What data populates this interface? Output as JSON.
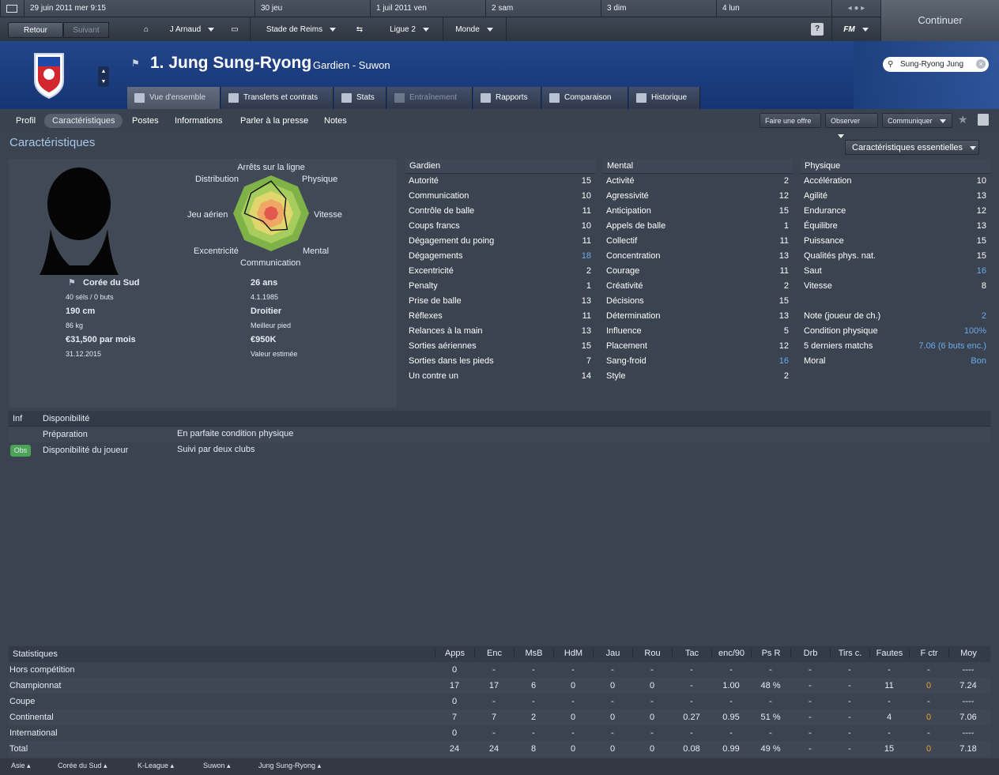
{
  "datebar": [
    {
      "label": "29 juin 2011  mer  9:15"
    },
    {
      "label": "30  jeu"
    },
    {
      "label": "1 juil 2011  ven"
    },
    {
      "label": "2  sam"
    },
    {
      "label": "3  dim"
    },
    {
      "label": "4  lun"
    }
  ],
  "nav": {
    "back": "Retour",
    "forward": "Suivant",
    "manager": "J Arnaud",
    "club": "Stade de Reims",
    "league": "Ligue 2",
    "world": "Monde",
    "help": "?",
    "fm": "FM",
    "continue": "Continuer"
  },
  "player": {
    "title": "1. Jung Sung-Ryong",
    "subtitle": "Gardien - Suwon",
    "search_value": "Sung-Ryong Jung"
  },
  "tabs": [
    "Vue d'ensemble",
    "Transferts et contrats",
    "Stats",
    "Entraînement",
    "Rapports",
    "Comparaison",
    "Historique"
  ],
  "subnav": [
    "Profil",
    "Caractéristiques",
    "Postes",
    "Informations",
    "Parler à la presse",
    "Notes"
  ],
  "actions": {
    "offer": "Faire une offre",
    "observe": "Observer",
    "communicate": "Communiquer"
  },
  "section_title": "Caractéristiques",
  "view_select": "Caractéristiques essentielles",
  "radar": {
    "labels": [
      "Arrêts sur la ligne",
      "Physique",
      "Vitesse",
      "Mental",
      "Communication",
      "Excentricité",
      "Jeu aérien",
      "Distribution"
    ]
  },
  "profile": {
    "nation": "Corée du Sud",
    "caps": "40 séls / 0 buts",
    "height": "190 cm",
    "weight": "86 kg",
    "wage": "€31,500 par mois",
    "contract_end": "31.12.2015",
    "age": "26 ans",
    "dob": "4.1.1985",
    "foot": "Droitier",
    "foot_label": "Meilleur pied",
    "value": "€950K",
    "value_label": "Valeur estimée"
  },
  "gk": {
    "title": "Gardien",
    "attrs": [
      [
        "Autorité",
        "15"
      ],
      [
        "Communication",
        "10"
      ],
      [
        "Contrôle de balle",
        "11"
      ],
      [
        "Coups francs",
        "10"
      ],
      [
        "Dégagement du poing",
        "11"
      ],
      [
        "Dégagements",
        "18"
      ],
      [
        "Excentricité",
        "2"
      ],
      [
        "Penalty",
        "1"
      ],
      [
        "Prise de balle",
        "13"
      ],
      [
        "Réflexes",
        "11"
      ],
      [
        "Relances à la main",
        "13"
      ],
      [
        "Sorties aériennes",
        "15"
      ],
      [
        "Sorties dans les pieds",
        "7"
      ],
      [
        "Un contre un",
        "14"
      ]
    ]
  },
  "mental": {
    "title": "Mental",
    "attrs": [
      [
        "Activité",
        "2"
      ],
      [
        "Agressivité",
        "12"
      ],
      [
        "Anticipation",
        "15"
      ],
      [
        "Appels de balle",
        "1"
      ],
      [
        "Collectif",
        "11"
      ],
      [
        "Concentration",
        "13"
      ],
      [
        "Courage",
        "11"
      ],
      [
        "Créativité",
        "2"
      ],
      [
        "Décisions",
        "15"
      ],
      [
        "Détermination",
        "13"
      ],
      [
        "Influence",
        "5"
      ],
      [
        "Placement",
        "12"
      ],
      [
        "Sang-froid",
        "16"
      ],
      [
        "Style",
        "2"
      ]
    ]
  },
  "physical": {
    "title": "Physique",
    "attrs": [
      [
        "Accélération",
        "10"
      ],
      [
        "Agilité",
        "13"
      ],
      [
        "Endurance",
        "12"
      ],
      [
        "Équilibre",
        "13"
      ],
      [
        "Puissance",
        "15"
      ],
      [
        "Qualités phys. nat.",
        "15"
      ],
      [
        "Saut",
        "16"
      ],
      [
        "Vitesse",
        "8"
      ]
    ]
  },
  "extra": [
    [
      "Note (joueur de ch.)",
      "2"
    ],
    [
      "Condition physique",
      "100%"
    ],
    [
      "5 derniers matchs",
      "7.06 (6 buts enc.)"
    ],
    [
      "Moral",
      "Bon"
    ]
  ],
  "availability": {
    "inf": "Inf",
    "title": "Disponibilité",
    "rows": [
      [
        "",
        "Préparation",
        "En parfaite condition physique"
      ],
      [
        "Obs",
        "Disponibilité du joueur",
        "Suivi par deux clubs"
      ]
    ]
  },
  "stats": {
    "title": "Statistiques",
    "columns": [
      "Apps",
      "Enc",
      "MsB",
      "HdM",
      "Jau",
      "Rou",
      "Tac",
      "enc/90",
      "Ps R",
      "Drb",
      "Tirs c.",
      "Fautes",
      "F ctr",
      "Moy"
    ],
    "rows": [
      [
        "Hors compétition",
        "0",
        "-",
        "-",
        "-",
        "-",
        "-",
        "-",
        "-",
        "-",
        "-",
        "-",
        "-",
        "-",
        "----"
      ],
      [
        "Championnat",
        "17",
        "17",
        "6",
        "0",
        "0",
        "0",
        "-",
        "1.00",
        "48 %",
        "-",
        "-",
        "11",
        "0",
        "7.24"
      ],
      [
        "Coupe",
        "0",
        "-",
        "-",
        "-",
        "-",
        "-",
        "-",
        "-",
        "-",
        "-",
        "-",
        "-",
        "-",
        "----"
      ],
      [
        "Continental",
        "7",
        "7",
        "2",
        "0",
        "0",
        "0",
        "0.27",
        "0.95",
        "51 %",
        "-",
        "-",
        "4",
        "0",
        "7.06"
      ],
      [
        "International",
        "0",
        "-",
        "-",
        "-",
        "-",
        "-",
        "-",
        "-",
        "-",
        "-",
        "-",
        "-",
        "-",
        "----"
      ],
      [
        "Total",
        "24",
        "24",
        "8",
        "0",
        "0",
        "0",
        "0.08",
        "0.99",
        "49 %",
        "-",
        "-",
        "15",
        "0",
        "7.18"
      ]
    ]
  },
  "breadcrumbs": [
    "Asie",
    "Corée du Sud",
    "K-League",
    "Suwon",
    "Jung Sung-Ryong"
  ]
}
